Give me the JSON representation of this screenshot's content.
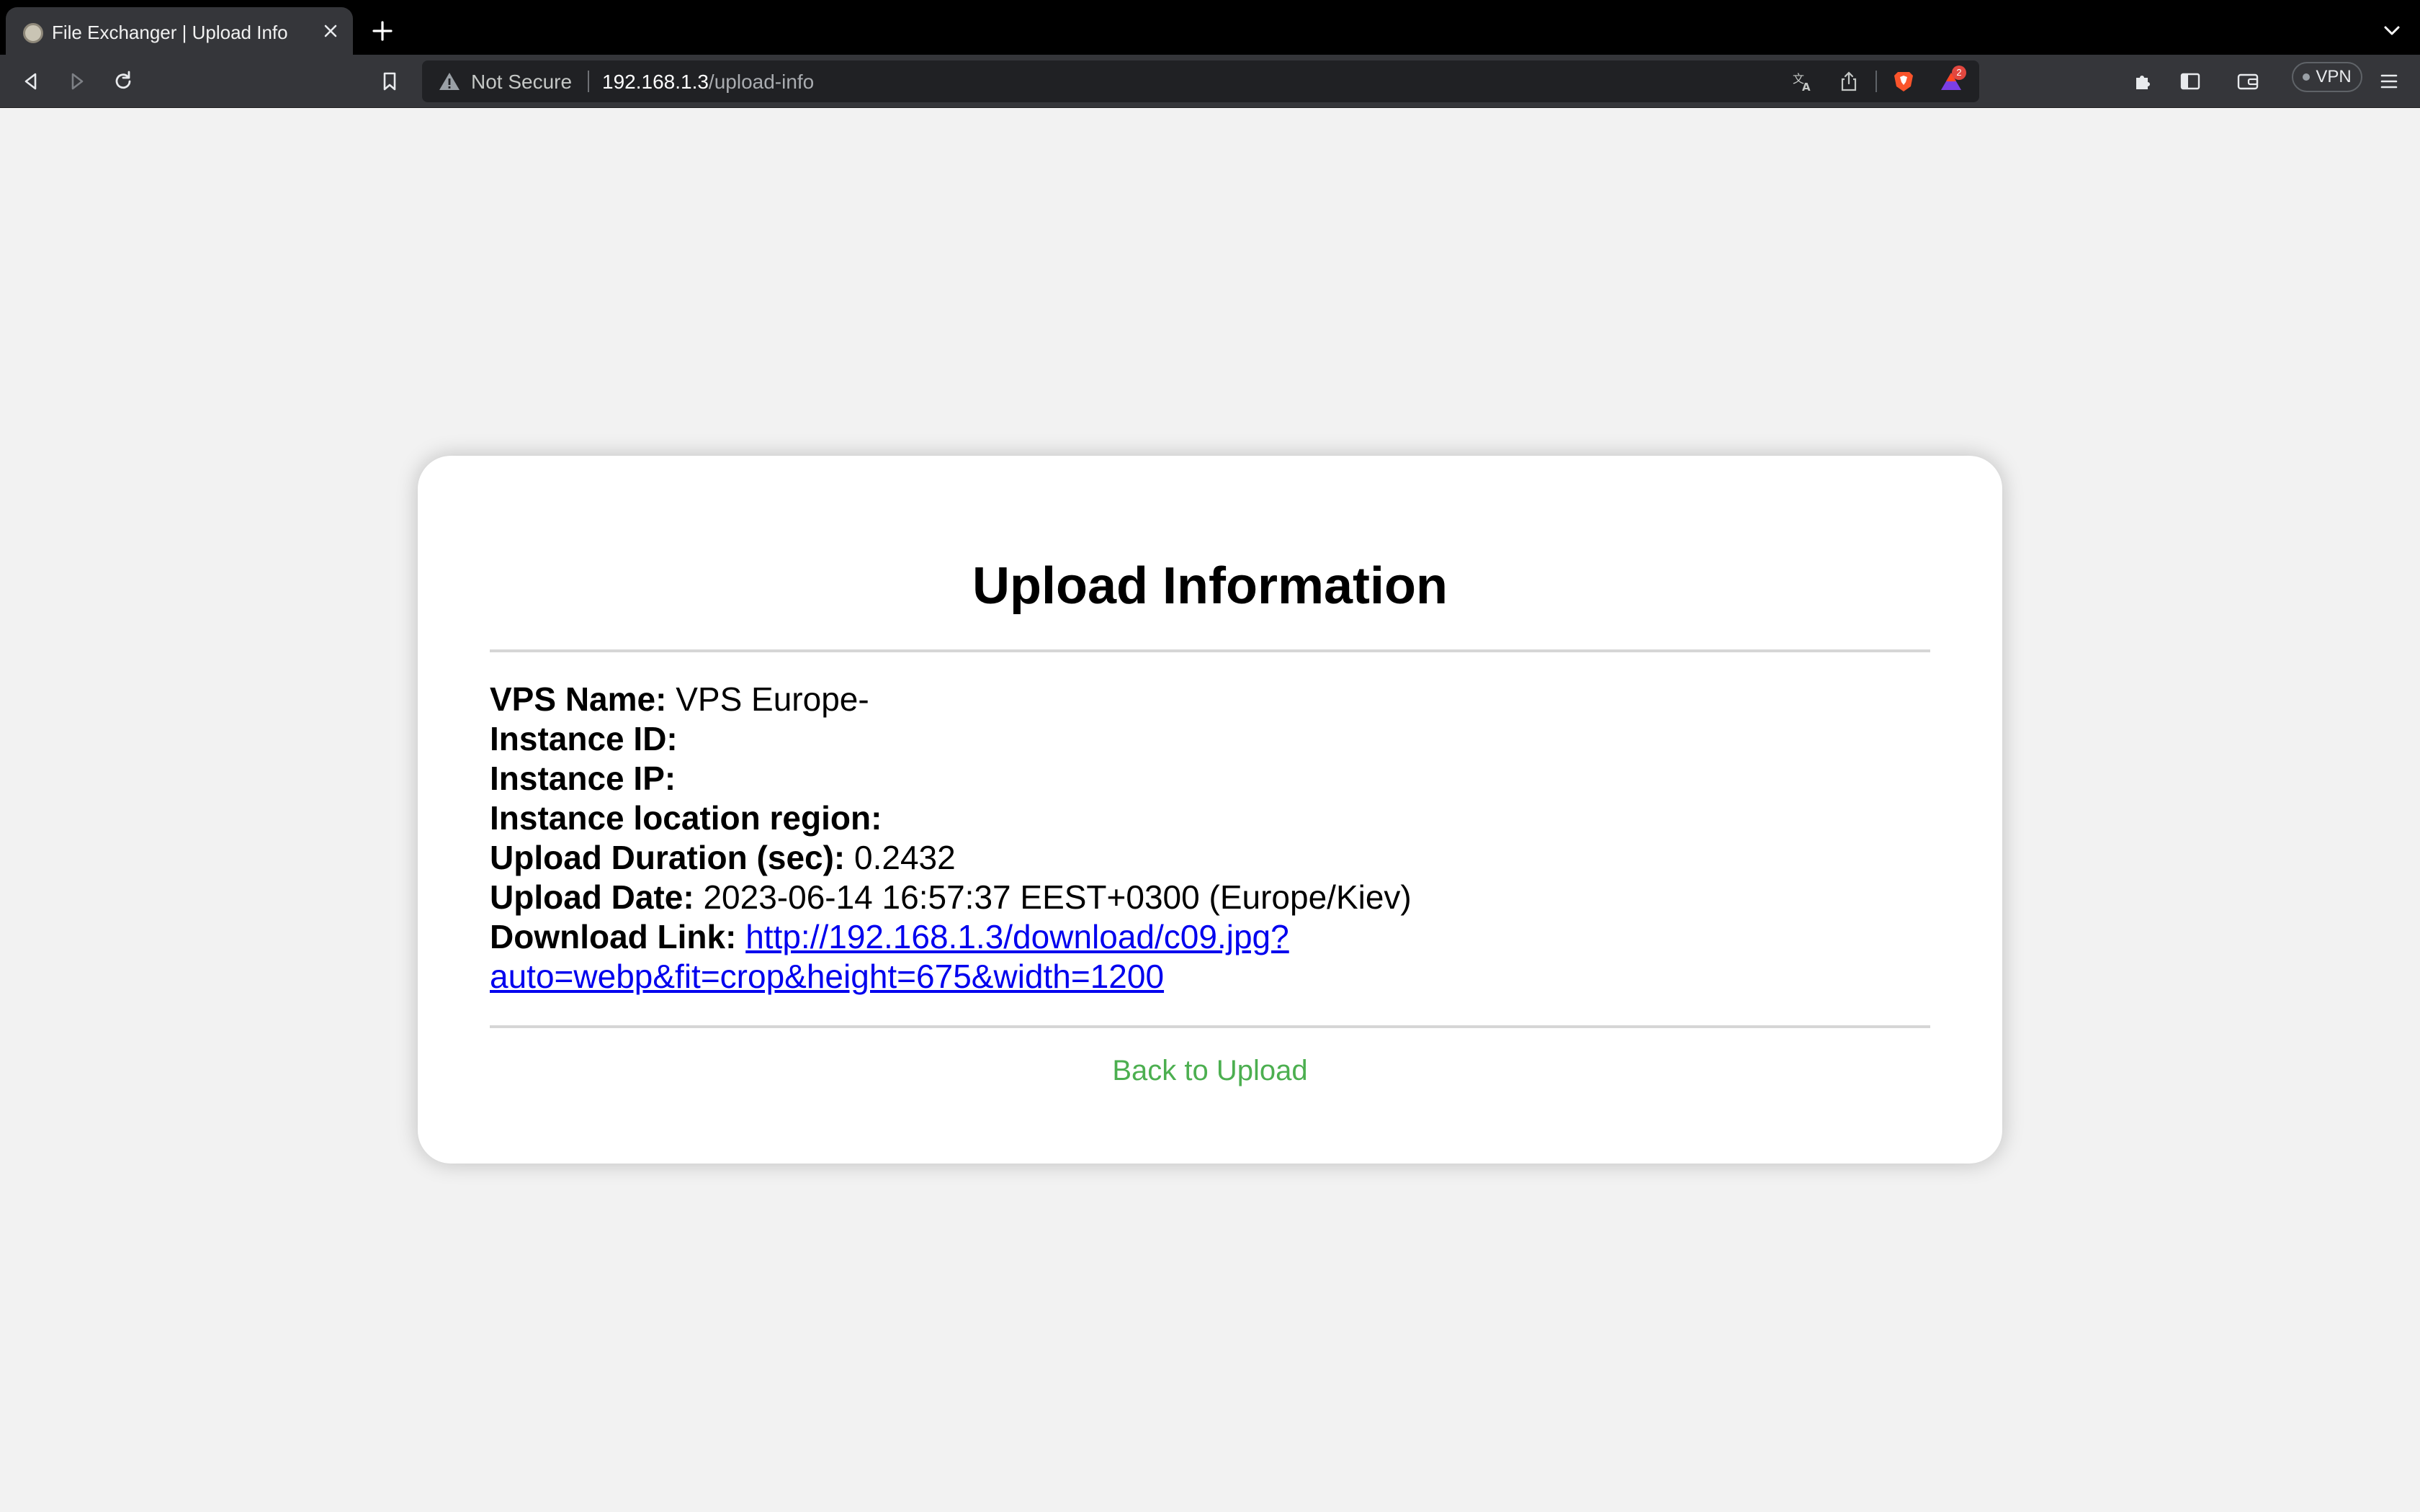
{
  "browser": {
    "tab_title": "File Exchanger | Upload Info",
    "security_label": "Not Secure",
    "url_host": "192.168.1.3",
    "url_path": "/upload-info",
    "notification_count": "2",
    "vpn_label": "VPN"
  },
  "page": {
    "heading": "Upload Information",
    "fields": [
      {
        "label": "VPS Name:",
        "value": " VPS Europe-"
      },
      {
        "label": "Instance ID:",
        "value": ""
      },
      {
        "label": "Instance IP:",
        "value": ""
      },
      {
        "label": "Instance location region:",
        "value": ""
      },
      {
        "label": "Upload Duration (sec):",
        "value": " 0.2432"
      },
      {
        "label": "Upload Date:",
        "value": " 2023-06-14 16:57:37 EEST+0300 (Europe/Kiev)"
      }
    ],
    "download": {
      "label": "Download Link:",
      "link_line1": "http://192.168.1.3/download/c09.jpg?",
      "link_line2": "auto=webp&fit=crop&height=675&width=1200",
      "href": "http://192.168.1.3/download/c09.jpg?auto=webp&fit=crop&height=675&width=1200"
    },
    "back_link": "Back to Upload"
  },
  "colors": {
    "link": "#0000ee",
    "back_link": "#4caf50",
    "page_bg": "#f2f2f2"
  }
}
